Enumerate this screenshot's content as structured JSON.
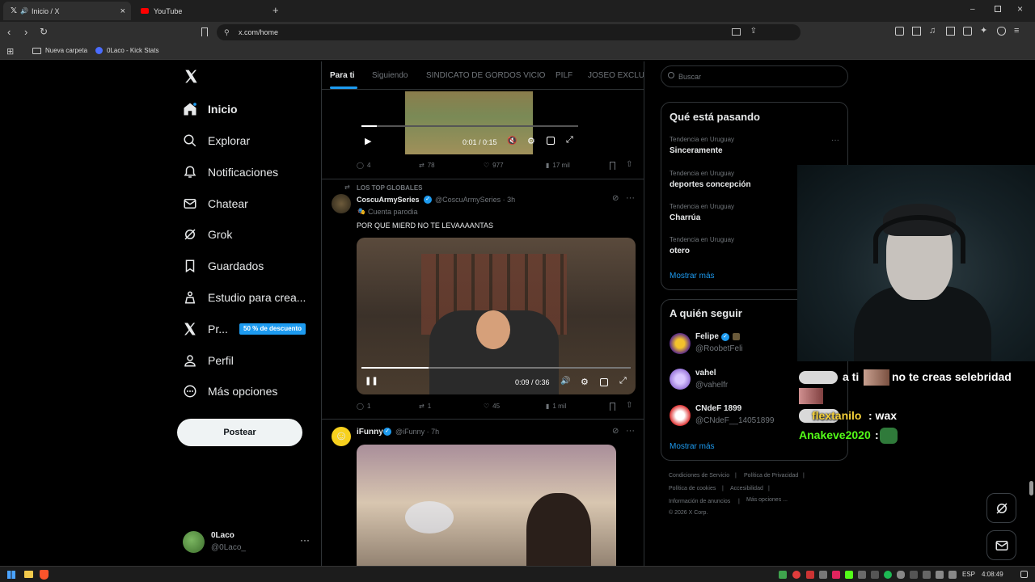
{
  "browser": {
    "tabs": [
      {
        "title": "Inicio / X",
        "active": true
      },
      {
        "title": "YouTube",
        "active": false
      }
    ],
    "url": "x.com/home",
    "bookmarks": [
      "Nueva carpeta",
      "0Laco - Kick Stats"
    ]
  },
  "nav": {
    "items": [
      {
        "label": "Inicio",
        "icon": "home-icon",
        "active": true
      },
      {
        "label": "Explorar",
        "icon": "search-icon"
      },
      {
        "label": "Notificaciones",
        "icon": "bell-icon"
      },
      {
        "label": "Chatear",
        "icon": "mail-icon"
      },
      {
        "label": "Grok",
        "icon": "grok-icon"
      },
      {
        "label": "Guardados",
        "icon": "bookmark-icon"
      },
      {
        "label": "Estudio para crea...",
        "icon": "creator-studio-icon"
      },
      {
        "label": "Pr...",
        "icon": "x-premium-icon"
      },
      {
        "label": "Perfil",
        "icon": "person-icon"
      },
      {
        "label": "Más opciones",
        "icon": "more-circle-icon"
      }
    ],
    "premium_badge": "50 % de descuento",
    "post_button": "Postear",
    "account": {
      "name": "0Laco",
      "handle": "@0Laco_"
    }
  },
  "feed": {
    "tabs": [
      "Para ti",
      "Siguiendo",
      "SINDICATO DE GORDOS VICIO",
      "PILF",
      "JOSEO EXCLUSI"
    ],
    "post1": {
      "video_time": "0:01 / 0:15",
      "progress": 0.07,
      "stats": {
        "replies": "4",
        "reposts": "78",
        "likes": "977",
        "views": "17 mil"
      }
    },
    "post2": {
      "context": "LOS TOP GLOBALES",
      "author": "CoscuArmySeries",
      "handle": "@CoscuArmySeries · 3h",
      "badge": "Cuenta parodia",
      "text": "POR QUE MIERD NO TE LEVAAAANTAS",
      "video_time": "0:09 / 0:36",
      "progress": 0.25,
      "stats": {
        "replies": "1",
        "reposts": "1",
        "likes": "45",
        "views": "1 mil"
      }
    },
    "post3": {
      "author": "iFunny",
      "handle": "@iFunny · 7h"
    }
  },
  "sidebar": {
    "search_placeholder": "Buscar",
    "trends_title": "Qué está pasando",
    "trends": [
      {
        "context": "Tendencia en Uruguay",
        "name": "Sinceramente"
      },
      {
        "context": "Tendencia en Uruguay",
        "name": "deportes concepción"
      },
      {
        "context": "Tendencia en Uruguay",
        "name": "Charrúa"
      },
      {
        "context": "Tendencia en Uruguay",
        "name": "otero"
      }
    ],
    "show_more": "Mostrar más",
    "follow_title": "A quién seguir",
    "follow": [
      {
        "name": "Felipe",
        "handle": "@RoobetFeli"
      },
      {
        "name": "vahel",
        "handle": "@vahelfr"
      },
      {
        "name": "CNdeF 1899",
        "handle": "@CNdeF__14051899"
      }
    ],
    "footer": [
      "Condiciones de Servicio",
      "|",
      "Política de Privacidad",
      "|",
      "Política de cookies",
      "|",
      "Accesibilidad",
      "|",
      "Información de anuncios",
      "|",
      "Más opciones ...",
      "© 2026 X Corp."
    ]
  },
  "overlay": {
    "chat": [
      {
        "text": "a ti",
        "suffix": "no te creas selebridad"
      },
      {
        "user": "flextanilo",
        "text": ": wax"
      },
      {
        "user": "Anakeve2020",
        "text": ":"
      }
    ]
  },
  "taskbar": {
    "lang": "ESP",
    "time": "4:08:49"
  },
  "colors": {
    "accent": "#1d9bf0",
    "background": "#000000",
    "border": "#2f3336",
    "chat_green": "#53fc18"
  }
}
